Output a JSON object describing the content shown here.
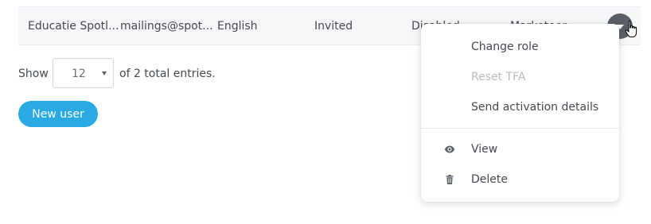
{
  "users_table": {
    "row": {
      "name": "Educatie Spotl...",
      "email": "mailings@spot...",
      "language": "English",
      "status": "Invited",
      "tfa": "Disabled",
      "role": "Marketeer"
    }
  },
  "pagination": {
    "show_label": "Show",
    "page_size": "12",
    "entries_text": "of 2 total entries."
  },
  "actions": {
    "new_user_label": "New user"
  },
  "row_menu": {
    "items": [
      {
        "label": "Change role",
        "enabled": true
      },
      {
        "label": "Reset TFA",
        "enabled": false
      },
      {
        "label": "Send activation details",
        "enabled": true
      },
      {
        "label": "View",
        "icon": "eye-icon",
        "enabled": true
      },
      {
        "label": "Delete",
        "icon": "trash-icon",
        "enabled": true
      }
    ]
  },
  "colors": {
    "accent": "#29aae3",
    "row_background": "#f7f7f9",
    "toggle_background": "#5b6068",
    "disabled_text": "#b8bcc1"
  }
}
